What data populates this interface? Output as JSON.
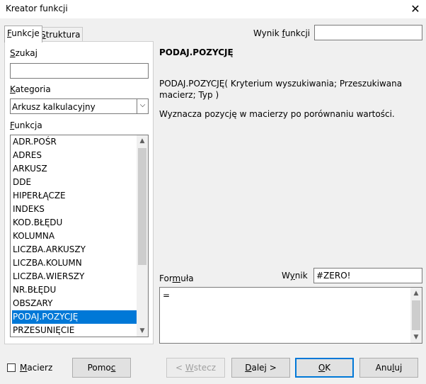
{
  "window": {
    "title": "Kreator funkcji",
    "close_glyph": "✕"
  },
  "tabs": [
    {
      "label_prefix": "",
      "underline": "F",
      "label_rest": "unkcje",
      "active": true
    },
    {
      "label_prefix": "",
      "underline": "S",
      "label_rest": "truktura",
      "active": false
    }
  ],
  "search": {
    "label_u": "S",
    "label_rest": "zukaj",
    "value": ""
  },
  "category": {
    "label_u": "K",
    "label_rest": "ategoria",
    "value": "Arkusz kalkulacyjny"
  },
  "function_list": {
    "label_u": "F",
    "label_rest": "unkcja",
    "items": [
      "ADR.POŚR",
      "ADRES",
      "ARKUSZ",
      "DDE",
      "HIPERŁĄCZE",
      "INDEKS",
      "KOD.BŁĘDU",
      "KOLUMNA",
      "LICZBA.ARKUSZY",
      "LICZBA.KOLUMN",
      "LICZBA.WIERSZY",
      "NR.BŁĘDU",
      "OBSZARY",
      "PODAJ.POZYCJĘ",
      "PRZESUNIĘCIE"
    ],
    "selected": "PODAJ.POZYCJĘ"
  },
  "result_top": {
    "label_pre": "Wynik ",
    "label_u": "f",
    "label_rest": "unkcji",
    "value": ""
  },
  "function_info": {
    "name": "PODAJ.POZYCJĘ",
    "syntax": "PODAJ.POZYCJĘ( Kryterium wyszukiwania; Przeszukiwana macierz; Typ )",
    "description": "Wyznacza pozycję w macierzy po porównaniu wartości."
  },
  "formula": {
    "label_pre": "For",
    "label_u": "m",
    "label_rest": "uła",
    "value": "="
  },
  "result": {
    "label_pre": "W",
    "label_u": "y",
    "label_rest": "nik",
    "value": "#ZERO!"
  },
  "bottom": {
    "array": {
      "label_u": "M",
      "label_rest": "acierz",
      "checked": false
    },
    "help": {
      "label_pre": "Pomo",
      "label_u": "c",
      "label_rest": ""
    },
    "back": {
      "label_pre": "< ",
      "label_u": "W",
      "label_rest": "stecz"
    },
    "next": {
      "label_pre": "",
      "label_u": "D",
      "label_rest": "alej >"
    },
    "ok": {
      "label_pre": "",
      "label_u": "O",
      "label_rest": "K"
    },
    "cancel": {
      "label_pre": "Anu",
      "label_u": "l",
      "label_rest": "uj"
    }
  }
}
